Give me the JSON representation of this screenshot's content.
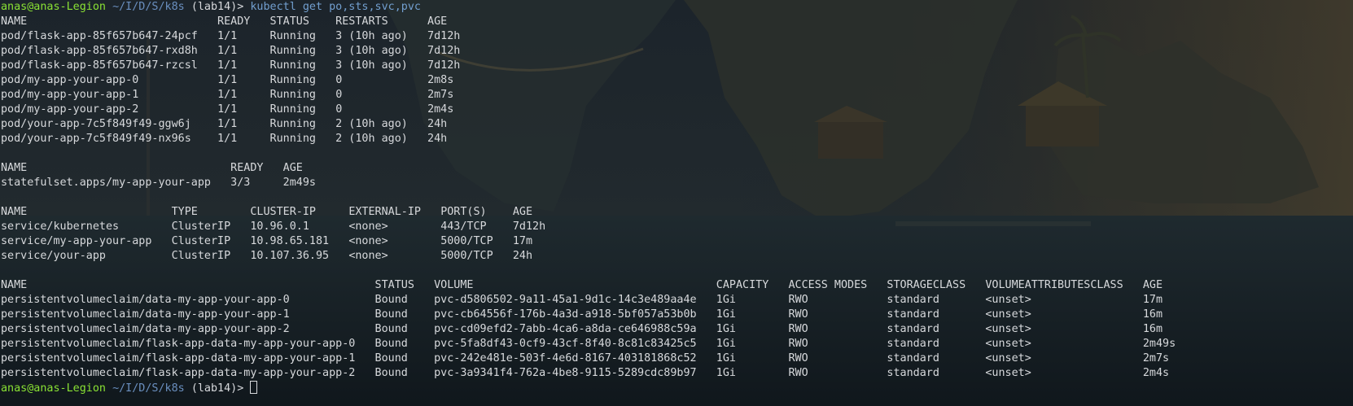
{
  "prompt": {
    "user": "anas@anas-Legion",
    "path": "~/I/D/S/k8s",
    "env": "(lab14)",
    "symbol": ">",
    "command": "kubectl get po,sts,svc,pvc"
  },
  "pods": {
    "headers": [
      "NAME",
      "READY",
      "STATUS",
      "RESTARTS",
      "AGE"
    ],
    "rows": [
      [
        "pod/flask-app-85f657b647-24pcf",
        "1/1",
        "Running",
        "3 (10h ago)",
        "7d12h"
      ],
      [
        "pod/flask-app-85f657b647-rxd8h",
        "1/1",
        "Running",
        "3 (10h ago)",
        "7d12h"
      ],
      [
        "pod/flask-app-85f657b647-rzcsl",
        "1/1",
        "Running",
        "3 (10h ago)",
        "7d12h"
      ],
      [
        "pod/my-app-your-app-0",
        "1/1",
        "Running",
        "0",
        "2m8s"
      ],
      [
        "pod/my-app-your-app-1",
        "1/1",
        "Running",
        "0",
        "2m7s"
      ],
      [
        "pod/my-app-your-app-2",
        "1/1",
        "Running",
        "0",
        "2m4s"
      ],
      [
        "pod/your-app-7c5f849f49-ggw6j",
        "1/1",
        "Running",
        "2 (10h ago)",
        "24h"
      ],
      [
        "pod/your-app-7c5f849f49-nx96s",
        "1/1",
        "Running",
        "2 (10h ago)",
        "24h"
      ]
    ]
  },
  "statefulsets": {
    "headers": [
      "NAME",
      "READY",
      "AGE"
    ],
    "rows": [
      [
        "statefulset.apps/my-app-your-app",
        "3/3",
        "2m49s"
      ]
    ]
  },
  "services": {
    "headers": [
      "NAME",
      "TYPE",
      "CLUSTER-IP",
      "EXTERNAL-IP",
      "PORT(S)",
      "AGE"
    ],
    "rows": [
      [
        "service/kubernetes",
        "ClusterIP",
        "10.96.0.1",
        "<none>",
        "443/TCP",
        "7d12h"
      ],
      [
        "service/my-app-your-app",
        "ClusterIP",
        "10.98.65.181",
        "<none>",
        "5000/TCP",
        "17m"
      ],
      [
        "service/your-app",
        "ClusterIP",
        "10.107.36.95",
        "<none>",
        "5000/TCP",
        "24h"
      ]
    ]
  },
  "pvcs": {
    "headers": [
      "NAME",
      "STATUS",
      "VOLUME",
      "CAPACITY",
      "ACCESS MODES",
      "STORAGECLASS",
      "VOLUMEATTRIBUTESCLASS",
      "AGE"
    ],
    "rows": [
      [
        "persistentvolumeclaim/data-my-app-your-app-0",
        "Bound",
        "pvc-d5806502-9a11-45a1-9d1c-14c3e489aa4e",
        "1Gi",
        "RWO",
        "standard",
        "<unset>",
        "17m"
      ],
      [
        "persistentvolumeclaim/data-my-app-your-app-1",
        "Bound",
        "pvc-cb64556f-176b-4a3d-a918-5bf057a53b0b",
        "1Gi",
        "RWO",
        "standard",
        "<unset>",
        "16m"
      ],
      [
        "persistentvolumeclaim/data-my-app-your-app-2",
        "Bound",
        "pvc-cd09efd2-7abb-4ca6-a8da-ce646988c59a",
        "1Gi",
        "RWO",
        "standard",
        "<unset>",
        "16m"
      ],
      [
        "persistentvolumeclaim/flask-app-data-my-app-your-app-0",
        "Bound",
        "pvc-5fa8df43-0cf9-43cf-8f40-8c81c83425c5",
        "1Gi",
        "RWO",
        "standard",
        "<unset>",
        "2m49s"
      ],
      [
        "persistentvolumeclaim/flask-app-data-my-app-your-app-1",
        "Bound",
        "pvc-242e481e-503f-4e6d-8167-403181868c52",
        "1Gi",
        "RWO",
        "standard",
        "<unset>",
        "2m7s"
      ],
      [
        "persistentvolumeclaim/flask-app-data-my-app-your-app-2",
        "Bound",
        "pvc-3a9341f4-762a-4be8-9115-5289cdc89b97",
        "1Gi",
        "RWO",
        "standard",
        "<unset>",
        "2m4s"
      ]
    ]
  },
  "colors": {
    "background": "#151c22",
    "text": "#d7d9dc",
    "prompt_user": "#8ae234",
    "prompt_path": "#6a8fbf",
    "command": "#729fcf"
  }
}
